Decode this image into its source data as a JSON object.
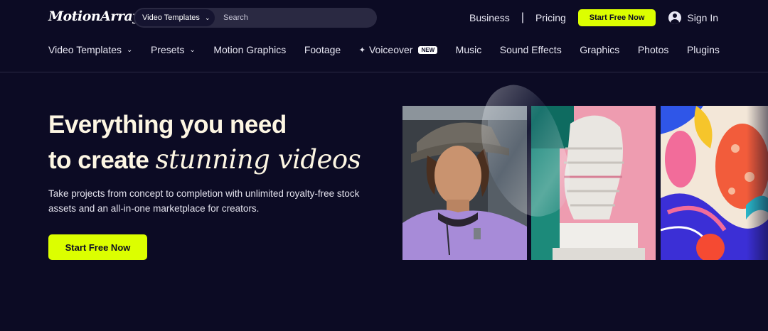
{
  "header": {
    "logo": "MotionArray",
    "search": {
      "category": "Video Templates",
      "placeholder": "Search"
    },
    "links": [
      "Business",
      "Pricing"
    ],
    "separator": "|",
    "cta": "Start Free Now",
    "signin": "Sign In"
  },
  "nav": {
    "items": [
      {
        "label": "Video Templates",
        "dropdown": true
      },
      {
        "label": "Presets",
        "dropdown": true
      },
      {
        "label": "Motion Graphics"
      },
      {
        "label": "Footage"
      },
      {
        "label": "Voiceover",
        "badge": "NEW"
      },
      {
        "label": "Music"
      },
      {
        "label": "Sound Effects"
      },
      {
        "label": "Graphics"
      },
      {
        "label": "Photos"
      },
      {
        "label": "Plugins"
      }
    ]
  },
  "hero": {
    "headline_line1": "Everything you need",
    "headline_line2_plain": "to create",
    "headline_line2_italic": "stunning videos",
    "subtext": "Take projects from concept to completion with unlimited royalty-free stock assets and an all-in-one marketplace for creators.",
    "cta": "Start Free Now"
  },
  "theme": {
    "background": "#0c0b24",
    "accent": "#dcff00",
    "headline_color": "#fdf6e3"
  }
}
